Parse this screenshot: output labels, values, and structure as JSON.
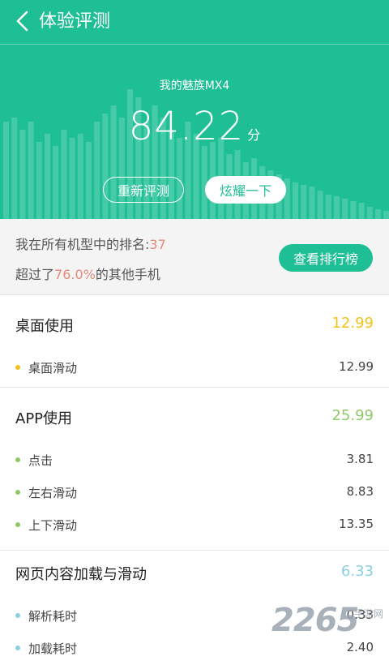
{
  "app": {
    "title": "体验评测"
  },
  "header": {
    "device_name": "我的魅族MX4",
    "score": "84.22",
    "score_unit": "分",
    "retest_label": "重新评测",
    "share_label": "炫耀一下",
    "bar_color": "#ffffff",
    "bg_color": "#1fbf95"
  },
  "rank": {
    "line1_prefix": "我在所有机型中的排名:",
    "line1_value": "37",
    "line2_prefix": "超过了",
    "line2_value": "76.0%",
    "line2_suffix": "的其他手机",
    "button_label": "查看排行榜"
  },
  "sections": [
    {
      "title": "桌面使用",
      "value": "12.99",
      "color": "#f2c21b",
      "items": [
        {
          "label": "桌面滑动",
          "value": "12.99"
        }
      ]
    },
    {
      "title": "APP使用",
      "value": "25.99",
      "color": "#8fc96a",
      "items": [
        {
          "label": "点击",
          "value": "3.81"
        },
        {
          "label": "左右滑动",
          "value": "8.83"
        },
        {
          "label": "上下滑动",
          "value": "13.35"
        }
      ]
    },
    {
      "title": "网页内容加载与滑动",
      "value": "6.33",
      "color": "#8ccfe0",
      "items": [
        {
          "label": "解析耗时",
          "value": "0.33"
        },
        {
          "label": "加载耗时",
          "value": "2.40"
        }
      ]
    }
  ],
  "watermark": {
    "number": "2265",
    "site": "手游网"
  }
}
